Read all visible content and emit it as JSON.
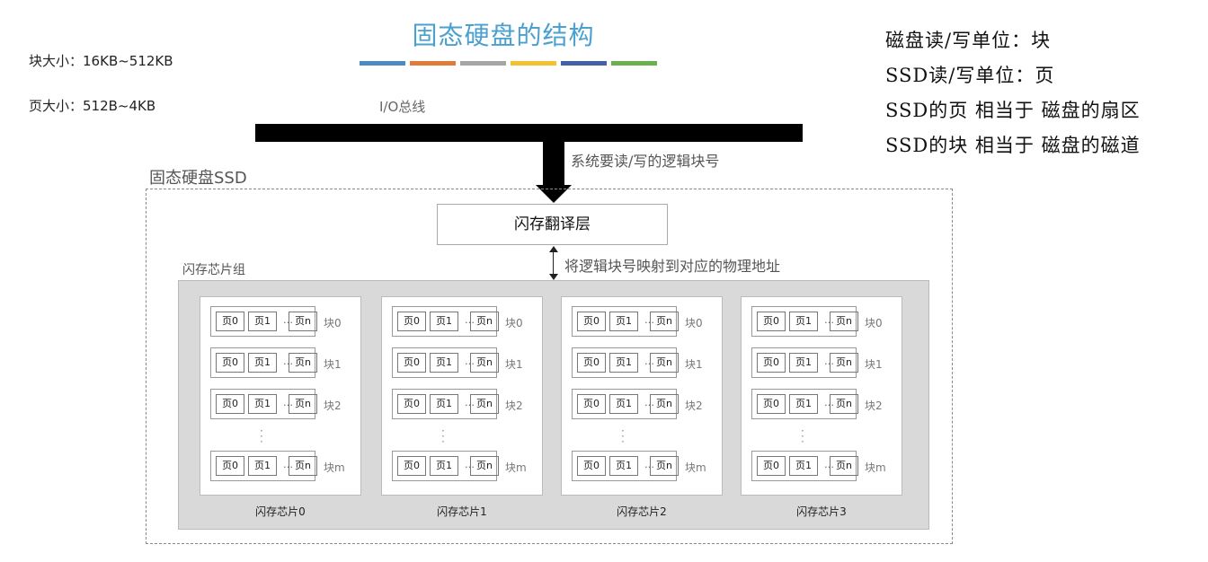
{
  "title": "固态硬盘的结构",
  "title_color_bars": [
    "#4a8bc4",
    "#e07b39",
    "#a5a5a5",
    "#f1c232",
    "#4461a8",
    "#6ab04c"
  ],
  "left_notes": [
    {
      "label": "块大小：",
      "value": "16KB~512KB"
    },
    {
      "label": "页大小：",
      "value": "512B~4KB"
    }
  ],
  "right_notes": [
    "磁盘读/写单位：块",
    "SSD读/写单位：页",
    "SSD的页 相当于 磁盘的扇区",
    "SSD的块 相当于 磁盘的磁道"
  ],
  "bus_label": "I/O总线",
  "request_label": "系统要读/写的逻辑块号",
  "ssd_title": "固态硬盘SSD",
  "ftl_label": "闪存翻译层",
  "mapping_label": "将逻辑块号映射到对应的物理地址",
  "chip_group_label": "闪存芯片组",
  "page_labels": [
    "页0",
    "页1",
    "…",
    "页n"
  ],
  "block_labels": [
    "块0",
    "块1",
    "块2",
    "块m"
  ],
  "chips": [
    "闪存芯片0",
    "闪存芯片1",
    "闪存芯片2",
    "闪存芯片3"
  ]
}
